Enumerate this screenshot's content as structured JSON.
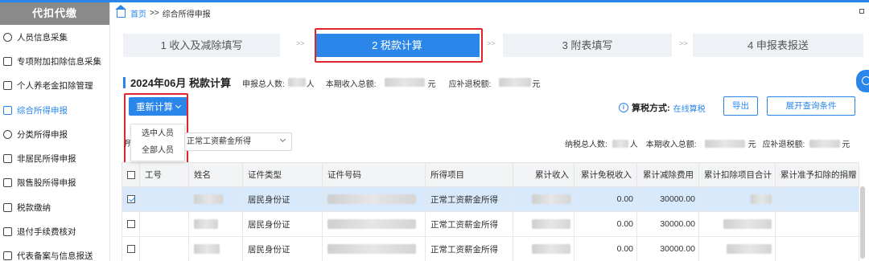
{
  "sidebar": {
    "header": "代扣代缴",
    "items": [
      {
        "label": "人员信息采集",
        "icon": "user-icon",
        "active": false
      },
      {
        "label": "专项附加扣除信息采集",
        "icon": "list-icon",
        "active": false
      },
      {
        "label": "个人养老金扣除管理",
        "icon": "wallet-icon",
        "active": false
      },
      {
        "label": "综合所得申报",
        "icon": "layers-icon",
        "active": true
      },
      {
        "label": "分类所得申报",
        "icon": "pie-icon",
        "active": false
      },
      {
        "label": "非居民所得申报",
        "icon": "document-icon",
        "active": false
      },
      {
        "label": "限售股所得申报",
        "icon": "lock-icon",
        "active": false
      },
      {
        "label": "税款缴纳",
        "icon": "payment-icon",
        "active": false
      },
      {
        "label": "退付手续费核对",
        "icon": "check-icon",
        "active": false
      },
      {
        "label": "代表备案与信息报送",
        "icon": "report-icon",
        "active": false
      }
    ]
  },
  "breadcrumb": {
    "home": "首页",
    "sep": ">>",
    "current": "综合所得申报"
  },
  "steps": [
    {
      "label": "1 收入及减除填写",
      "active": false
    },
    {
      "label": "2 税款计算",
      "active": true
    },
    {
      "label": "3 附表填写",
      "active": false
    },
    {
      "label": "4 申报表报送",
      "active": false
    }
  ],
  "step_separator": ">>",
  "summary": {
    "title": "2024年06月  税款计算",
    "people_label": "申报总人数:",
    "people_unit": "人",
    "income_label": "本期收入总额:",
    "income_unit": "元",
    "refund_label": "应补退税额:",
    "refund_unit": "元"
  },
  "actions": {
    "recalc_label": "重新计算",
    "dropdown_items": [
      "选中人员",
      "全部人员"
    ],
    "tax_method_label": "算税方式:",
    "tax_method_value": "在线算税",
    "export_label": "导出",
    "expand_label": "展开查询条件"
  },
  "filter": {
    "left_label": "所",
    "select_value": "正常工资薪金所得",
    "people_label": "纳税总人数:",
    "people_unit": "人",
    "income_label": "本期收入总额:",
    "income_unit": "元",
    "refund_label": "应补退税额:",
    "refund_unit": "元"
  },
  "table": {
    "headers": [
      "工号",
      "姓名",
      "证件类型",
      "证件号码",
      "所得项目",
      "累计收入",
      "累计免税收入",
      "累计减除费用",
      "累计扣除项目合计",
      "累计准予扣除的捐赠"
    ],
    "rows": [
      {
        "checked": true,
        "id_type": "居民身份证",
        "income_item": "正常工资薪金所得",
        "tax_free": "0.00",
        "deduction": "30000.00"
      },
      {
        "checked": false,
        "id_type": "居民身份证",
        "income_item": "正常工资薪金所得",
        "tax_free": "0.00",
        "deduction": "30000.00"
      },
      {
        "checked": false,
        "id_type": "居民身份证",
        "income_item": "正常工资薪金所得",
        "tax_free": "0.00",
        "deduction": "30000.00"
      }
    ]
  },
  "colors": {
    "accent": "#2a86e8",
    "highlight": "#e0262c",
    "selected_row": "#d8e9fb"
  }
}
